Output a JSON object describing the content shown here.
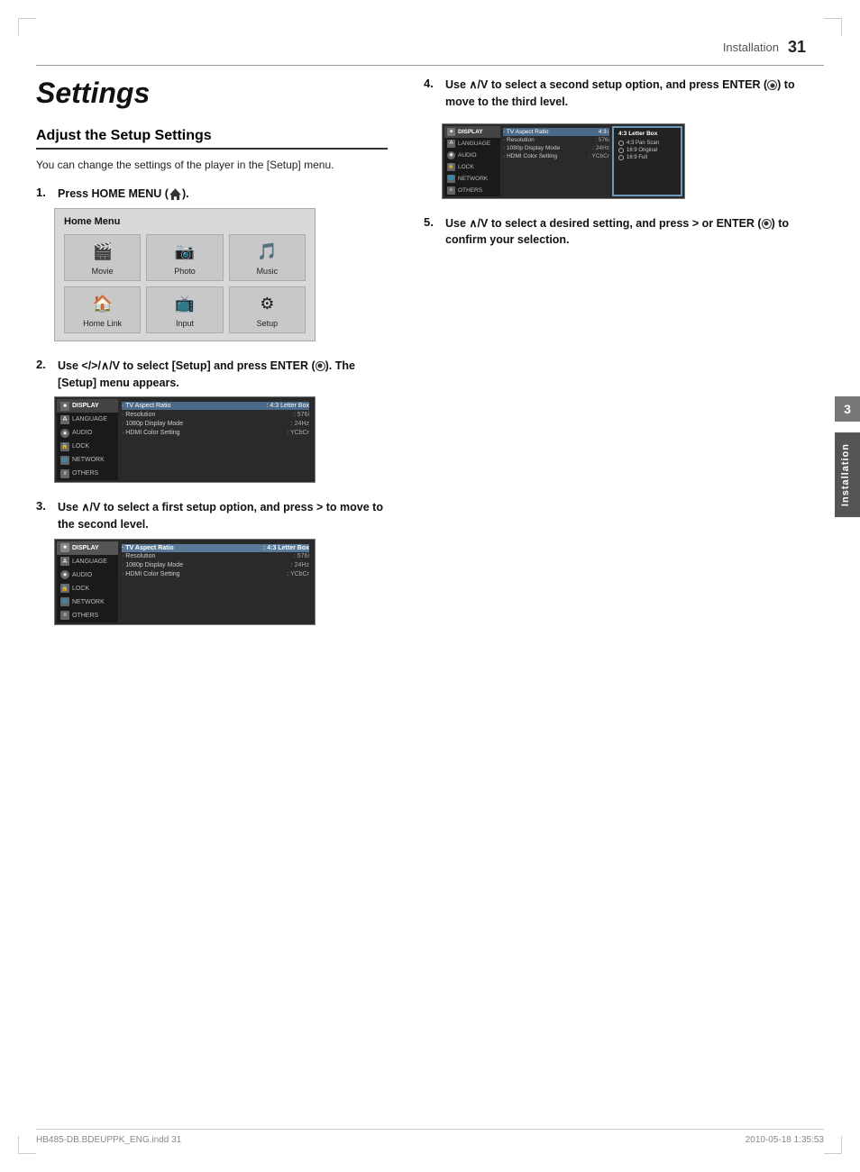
{
  "page": {
    "number": "31",
    "header_title": "Installation",
    "footer_left": "HB485-DB.BDEUPPK_ENG.indd   31",
    "footer_right": "2010-05-18      1:35:53"
  },
  "main_title": "Settings",
  "section_title": "Adjust the Setup Settings",
  "intro_text": "You can change the settings of the player in the [Setup] menu.",
  "steps": [
    {
      "number": "1.",
      "text": "Press HOME MENU (",
      "text_suffix": ").",
      "has_home_icon": true
    },
    {
      "number": "2.",
      "text": "Use </>/∧/V to select [Setup] and press ENTER (",
      "text_suffix": "). The [Setup] menu appears.",
      "has_enter_icon": true
    },
    {
      "number": "3.",
      "text": "Use ∧/V to select a first setup option, and press > to move to the second level."
    }
  ],
  "right_steps": [
    {
      "number": "4.",
      "text": "Use ∧/V to select a second setup option, and press ENTER (",
      "text_suffix": ") to move to the third level.",
      "has_enter_icon": true
    },
    {
      "number": "5.",
      "text": "Use ∧/V to select a desired setting, and press > or ENTER (",
      "text_suffix": ") to confirm your selection.",
      "has_enter_icon": true
    }
  ],
  "home_menu": {
    "title": "Home Menu",
    "items_row1": [
      {
        "label": "Movie",
        "icon": "🎬"
      },
      {
        "label": "Photo",
        "icon": "📷"
      },
      {
        "label": "Music",
        "icon": "🎵"
      }
    ],
    "items_row2": [
      {
        "label": "Home Link",
        "icon": "🏠"
      },
      {
        "label": "Input",
        "icon": "📺"
      },
      {
        "label": "Setup",
        "icon": "⚙"
      }
    ]
  },
  "setup_menu": {
    "items": [
      {
        "label": "DISPLAY",
        "icon": "D",
        "active": true
      },
      {
        "label": "LANGUAGE",
        "icon": "A"
      },
      {
        "label": "AUDIO",
        "icon": "◉"
      },
      {
        "label": "LOCK",
        "icon": "🔒"
      },
      {
        "label": "NETWORK",
        "icon": "N"
      },
      {
        "label": "OTHERS",
        "icon": "≡"
      }
    ],
    "options": [
      {
        "label": "· TV Aspect Ratio",
        "value": ": 4:3 Letter Box",
        "highlight": true
      },
      {
        "label": "· Resolution",
        "value": ": 576i"
      },
      {
        "label": "· 1080p Display Mode",
        "value": ": 24Hz"
      },
      {
        "label": "· HDMI Color Setting",
        "value": ": YCbCr"
      }
    ]
  },
  "third_level": {
    "title": "4:3 Letter Box",
    "options": [
      {
        "label": "4:3 Pan Scan",
        "selected": false
      },
      {
        "label": "16:9 Original",
        "selected": false
      },
      {
        "label": "16:9 Full",
        "selected": false
      }
    ]
  },
  "side_tab": {
    "number": "3",
    "label": "Installation"
  }
}
